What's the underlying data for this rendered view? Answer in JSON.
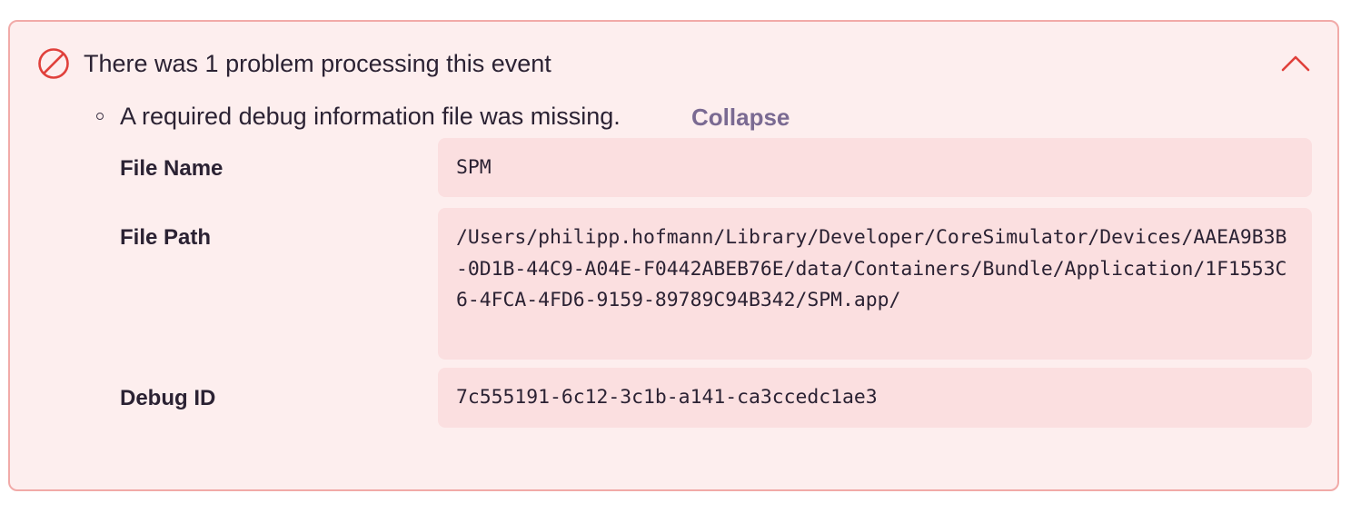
{
  "alert": {
    "title": "There was 1 problem processing this event",
    "icon": "circle-slash-icon",
    "toggle_icon": "chevron-up-icon",
    "accent_color": "#e0403b",
    "background_color": "#fdeeee",
    "border_color": "#f1aaa8"
  },
  "problem": {
    "message": "A required debug information file was missing.",
    "collapse_label": "Collapse",
    "details": [
      {
        "label": "File Name",
        "value": "SPM"
      },
      {
        "label": "File Path",
        "value": "/Users/philipp.hofmann/Library/Developer/CoreSimulator/Devices/AAEA9B3B-0D1B-44C9-A04E-F0442ABEB76E/data/Containers/Bundle/Application/1F1553C6-4FCA-4FD6-9159-89789C94B342/SPM.app/"
      },
      {
        "label": "Debug ID",
        "value": "7c555191-6c12-3c1b-a141-ca3ccedc1ae3"
      }
    ]
  }
}
